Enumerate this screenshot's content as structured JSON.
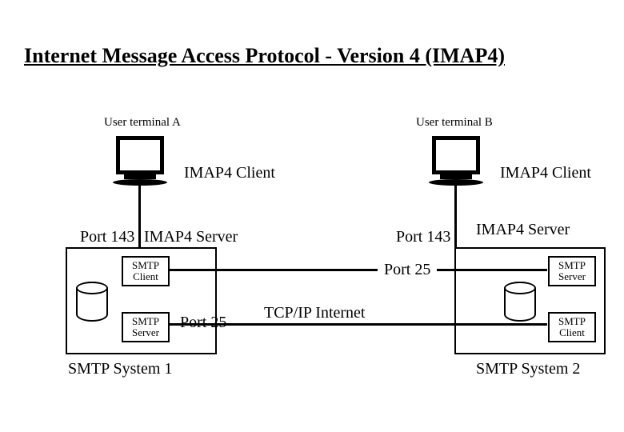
{
  "title": "Internet Message Access Protocol - Version 4 (IMAP4)",
  "left": {
    "terminal": "User terminal A",
    "client": "IMAP4 Client",
    "port": "Port 143",
    "server": "IMAP4 Server",
    "smtp_client": "SMTP\nClient",
    "smtp_server": "SMTP\nServer",
    "port25": "Port 25",
    "system": "SMTP System 1"
  },
  "right": {
    "terminal": "User terminal B",
    "client": "IMAP4 Client",
    "port": "Port 143",
    "server": "IMAP4 Server",
    "smtp_server": "SMTP\nServer",
    "smtp_client": "SMTP\nClient",
    "port25": "Port 25",
    "system": "SMTP System 2"
  },
  "center": "TCP/IP Internet"
}
